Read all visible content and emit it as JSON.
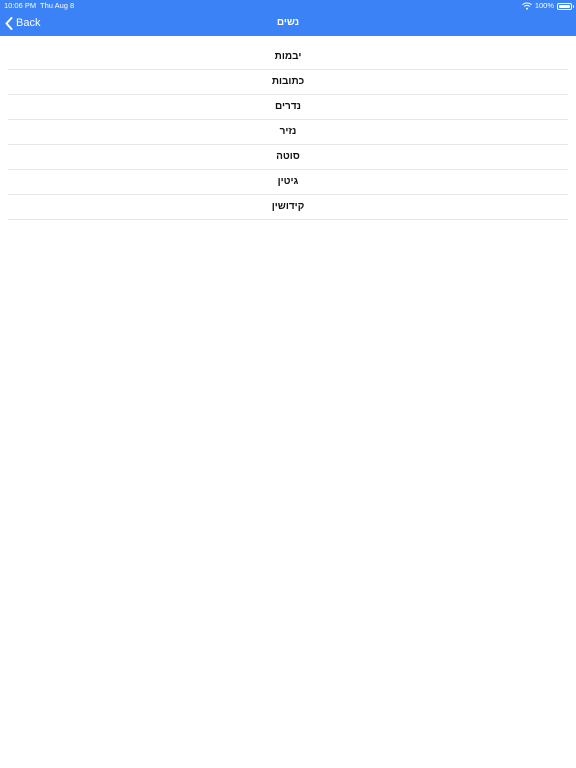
{
  "status_bar": {
    "time": "10:06 PM",
    "date": "Thu Aug 8",
    "battery": "100%",
    "icons": [
      "wifi-icon",
      "battery-icon"
    ]
  },
  "nav": {
    "back_label": "Back",
    "back_icon": "chevron-left-icon",
    "title": "נשים"
  },
  "colors": {
    "header_bg": "#3b82f6",
    "header_text": "#ffffff",
    "separator": "#e6e6e6"
  },
  "list": {
    "items": [
      {
        "label": "יבמות"
      },
      {
        "label": "כתובות"
      },
      {
        "label": "נדרים"
      },
      {
        "label": "נזיר"
      },
      {
        "label": "סוטה"
      },
      {
        "label": "גיטין"
      },
      {
        "label": "קידושין"
      }
    ]
  }
}
